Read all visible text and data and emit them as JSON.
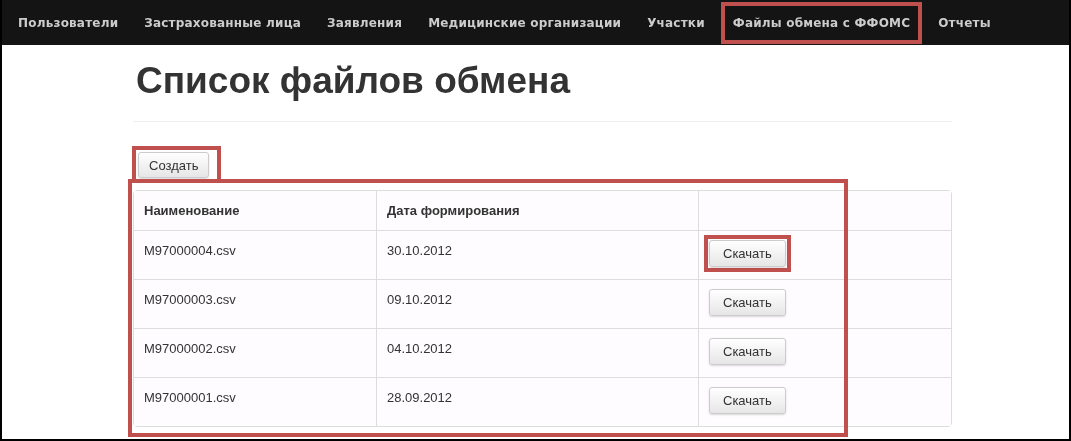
{
  "nav": [
    {
      "label": "Пользователи",
      "highlighted": false
    },
    {
      "label": "Застрахованные лица",
      "highlighted": false
    },
    {
      "label": "Заявления",
      "highlighted": false
    },
    {
      "label": "Медицинские организации",
      "highlighted": false
    },
    {
      "label": "Участки",
      "highlighted": false
    },
    {
      "label": "Файлы обмена с ФФОМС",
      "highlighted": true
    },
    {
      "label": "Отчеты",
      "highlighted": false
    }
  ],
  "title": "Список файлов обмена",
  "create_button": {
    "label": "Создать",
    "highlighted": true
  },
  "table": {
    "highlighted": true,
    "columns": [
      "Наименование",
      "Дата формирования"
    ],
    "rows": [
      {
        "name": "M97000004.csv",
        "date": "30.10.2012",
        "button": "Скачать",
        "highlighted": true
      },
      {
        "name": "M97000003.csv",
        "date": "09.10.2012",
        "button": "Скачать",
        "highlighted": false
      },
      {
        "name": "M97000002.csv",
        "date": "04.10.2012",
        "button": "Скачать",
        "highlighted": false
      },
      {
        "name": "M97000001.csv",
        "date": "28.09.2012",
        "button": "Скачать",
        "highlighted": false
      }
    ]
  }
}
